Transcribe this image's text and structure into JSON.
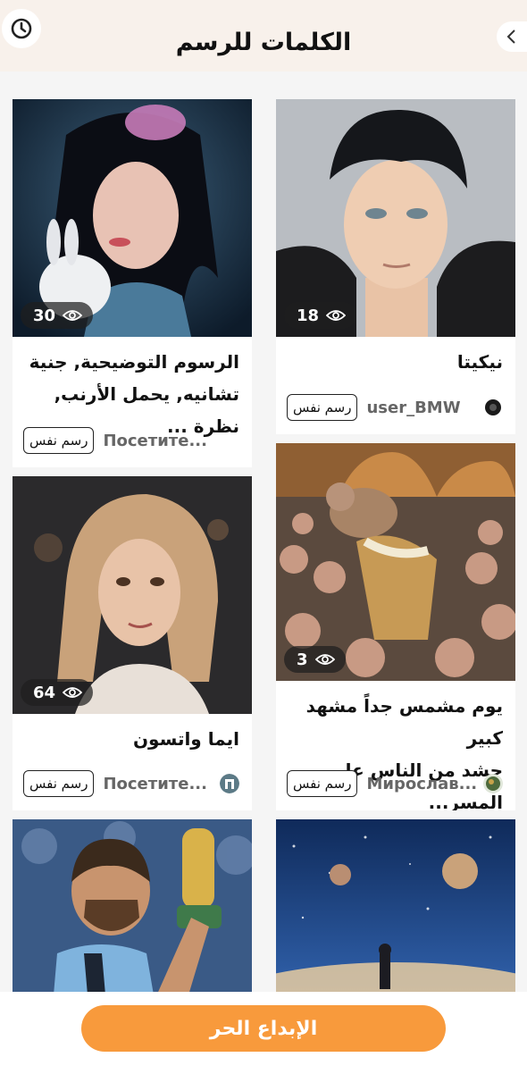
{
  "header": {
    "title": "الكلمات للرسم",
    "history_icon": "clock-icon",
    "back_icon": "chevron-left-icon"
  },
  "cards": [
    {
      "title": "الرسوم التوضيحية, جنية\nتشانيه, يحمل الأرنب, نظرة ...",
      "views": "30",
      "user": "Посетите...",
      "button": "رسم نفس",
      "has_avatar": false
    },
    {
      "title": "نيكيتا",
      "views": "18",
      "user": "user_BMW",
      "button": "رسم نفس",
      "has_avatar": true
    },
    {
      "title": "ايما واتسون",
      "views": "64",
      "user": "Посетите...",
      "button": "رسم نفس",
      "has_avatar": true
    },
    {
      "title": "يوم مشمس جداً مشهد كبير\nحشد من الناس على المسر...",
      "views": "3",
      "user": "Мирослав...",
      "button": "رسم نفس",
      "has_avatar": true
    }
  ],
  "bottom": {
    "cta_label": "الإبداع الحر"
  },
  "colors": {
    "accent": "#f89a3c",
    "header_bg": "#f8f1eb"
  }
}
